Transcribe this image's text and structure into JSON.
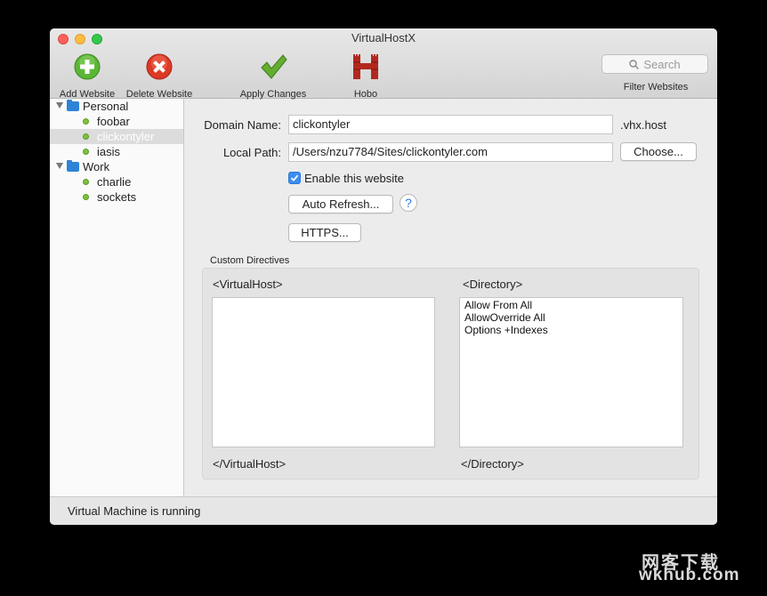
{
  "window": {
    "title": "VirtualHostX"
  },
  "toolbar": {
    "add_label": "Add Website",
    "delete_label": "Delete Website",
    "apply_label": "Apply Changes",
    "hobo_label": "Hobo",
    "search_placeholder": "Search",
    "filter_label": "Filter Websites"
  },
  "sidebar": {
    "groups": [
      {
        "label": "Personal",
        "items": [
          "foobar",
          "clickontyler",
          "iasis"
        ]
      },
      {
        "label": "Work",
        "items": [
          "charlie",
          "sockets"
        ]
      }
    ],
    "selected": "clickontyler"
  },
  "form": {
    "domain_label": "Domain Name:",
    "domain_value": "clickontyler",
    "domain_suffix": ".vhx.host",
    "path_label": "Local Path:",
    "path_value": "/Users/nzu7784/Sites/clickontyler.com",
    "choose_label": "Choose...",
    "enable_label": "Enable this website",
    "enable_checked": true,
    "auto_refresh_label": "Auto Refresh...",
    "help_label": "?",
    "https_label": "HTTPS..."
  },
  "directives": {
    "title": "Custom Directives",
    "vhost_open": "<VirtualHost>",
    "vhost_close": "</VirtualHost>",
    "vhost_content": "",
    "dir_open": "<Directory>",
    "dir_close": "</Directory>",
    "dir_lines": [
      "Allow From All",
      "AllowOverride All",
      "Options +Indexes"
    ]
  },
  "status": {
    "text": "Virtual Machine is running"
  },
  "watermark": {
    "line1": "网客下载",
    "line2": "wkhub.com"
  },
  "colors": {
    "accent": "#3b8ef3",
    "add": "#4caf2a",
    "delete": "#d9321f",
    "apply": "#5aa52c",
    "hobo": "#b3281e"
  }
}
